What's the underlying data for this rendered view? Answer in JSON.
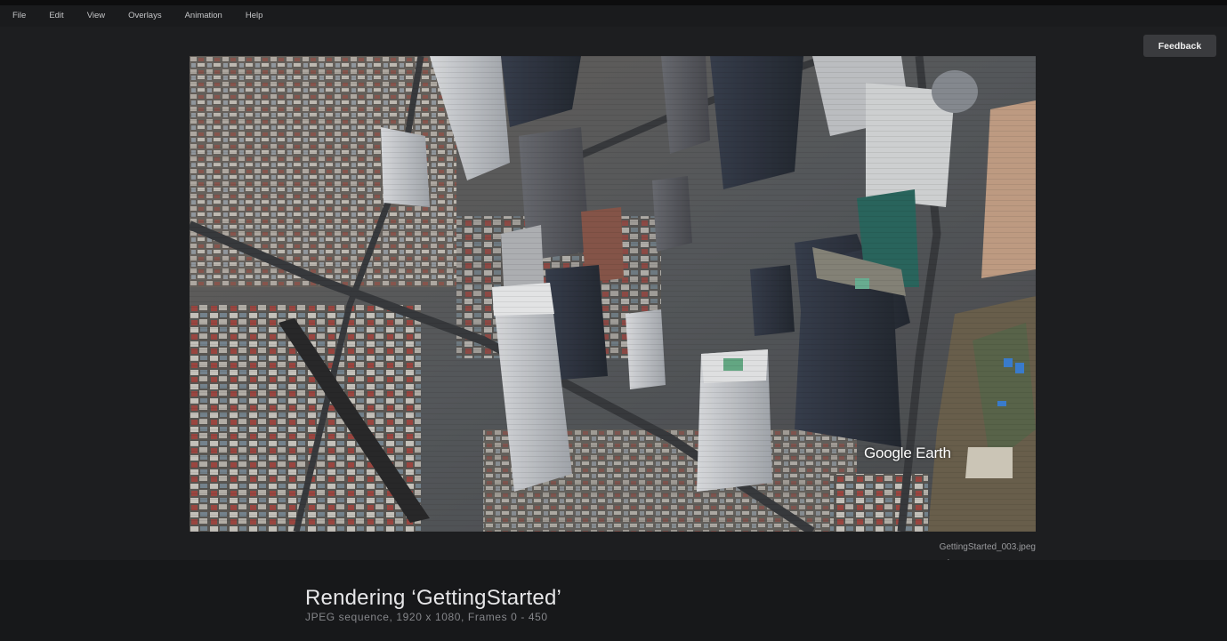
{
  "menu": {
    "items": [
      {
        "label": "File"
      },
      {
        "label": "Edit"
      },
      {
        "label": "View"
      },
      {
        "label": "Overlays"
      },
      {
        "label": "Animation"
      },
      {
        "label": "Help"
      }
    ]
  },
  "header": {
    "feedback_label": "Feedback"
  },
  "preview": {
    "watermark": "Google Earth",
    "filename": "GettingStarted_003.jpeg"
  },
  "render": {
    "title": "Rendering ‘GettingStarted’",
    "subtitle": "JPEG sequence, 1920 x 1080, Frames 0 - 450"
  },
  "icons": {
    "cursor": "mouse-pointer-icon"
  },
  "colors": {
    "background": "#1d1e20",
    "footer": "#17181a",
    "button": "#3a3b3e"
  }
}
